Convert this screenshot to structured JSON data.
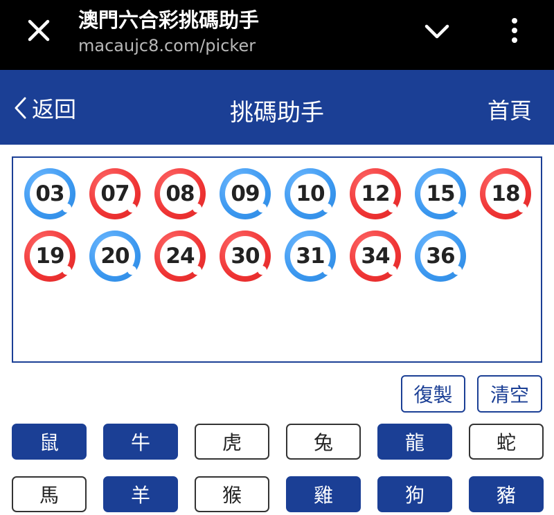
{
  "browser": {
    "title": "澳門六合彩挑碼助手",
    "url": "macaujc8.com/picker"
  },
  "header": {
    "back_label": "返回",
    "title": "挑碼助手",
    "home_label": "首頁"
  },
  "colors": {
    "primary": "#1b3f95",
    "ball_red": "#ef3434",
    "ball_blue": "#3a97ef"
  },
  "balls": [
    {
      "number": "03",
      "color": "blue"
    },
    {
      "number": "07",
      "color": "red"
    },
    {
      "number": "08",
      "color": "red"
    },
    {
      "number": "09",
      "color": "blue"
    },
    {
      "number": "10",
      "color": "blue"
    },
    {
      "number": "12",
      "color": "red"
    },
    {
      "number": "15",
      "color": "blue"
    },
    {
      "number": "18",
      "color": "red"
    },
    {
      "number": "19",
      "color": "red"
    },
    {
      "number": "20",
      "color": "blue"
    },
    {
      "number": "24",
      "color": "red"
    },
    {
      "number": "30",
      "color": "red"
    },
    {
      "number": "31",
      "color": "blue"
    },
    {
      "number": "34",
      "color": "red"
    },
    {
      "number": "36",
      "color": "blue"
    }
  ],
  "actions": {
    "copy_label": "復製",
    "clear_label": "清空"
  },
  "zodiacs": [
    {
      "label": "鼠",
      "selected": true
    },
    {
      "label": "牛",
      "selected": true
    },
    {
      "label": "虎",
      "selected": false
    },
    {
      "label": "兔",
      "selected": false
    },
    {
      "label": "龍",
      "selected": true
    },
    {
      "label": "蛇",
      "selected": false
    },
    {
      "label": "馬",
      "selected": false
    },
    {
      "label": "羊",
      "selected": true
    },
    {
      "label": "猴",
      "selected": false
    },
    {
      "label": "雞",
      "selected": true
    },
    {
      "label": "狗",
      "selected": true
    },
    {
      "label": "豬",
      "selected": true
    }
  ]
}
